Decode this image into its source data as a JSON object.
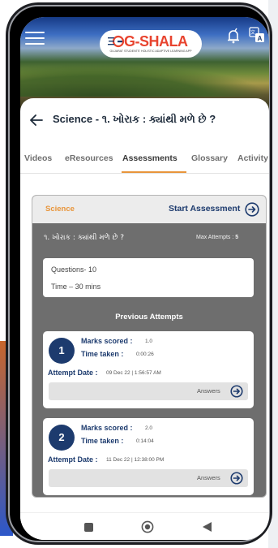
{
  "header": {
    "logo_text": "G-SHALA",
    "logo_tagline": "GUJARAT STUDENTS' HOLISTIC ADAPTIVE LEARNING APP",
    "menu_icon": "hamburger-menu-icon",
    "bell_icon": "notification-bell-icon",
    "translate_icon": "translate-icon"
  },
  "page": {
    "title": "Science - ૧. ખોરાક : ક્યાંથી મળે છે ?"
  },
  "tabs": [
    {
      "label": "Videos",
      "active": false
    },
    {
      "label": "eResources",
      "active": false
    },
    {
      "label": "Assessments",
      "active": true
    },
    {
      "label": "Glossary",
      "active": false
    },
    {
      "label": "Activity",
      "active": false
    }
  ],
  "assessment": {
    "subject": "Science",
    "start_label": "Start Assessment",
    "topic": "૧. ખોરાક : ક્યાંથી મળે છે ?",
    "max_attempts_label": "Max Attempts :",
    "max_attempts_value": "5",
    "questions": "Questions- 10",
    "time": "Time – 30 mins",
    "previous_heading": "Previous Attempts"
  },
  "attempts": [
    {
      "number": "1",
      "marks_label": "Marks scored :",
      "marks_value": "1.0",
      "time_label": "Time taken :",
      "time_value": "0:00:26",
      "date_label": "Attempt Date :",
      "date_value": "09 Dec 22 | 1:56:57 AM",
      "answers_label": "Answers"
    },
    {
      "number": "2",
      "marks_label": "Marks scored :",
      "marks_value": "2.0",
      "time_label": "Time taken :",
      "time_value": "0:14:04",
      "date_label": "Attempt Date :",
      "date_value": "11 Dec 22 | 12:38:00 PM",
      "answers_label": "Answers"
    }
  ],
  "colors": {
    "accent_orange": "#e8953b",
    "navy": "#1d3b6e",
    "card_gray": "#6e6e6e"
  }
}
